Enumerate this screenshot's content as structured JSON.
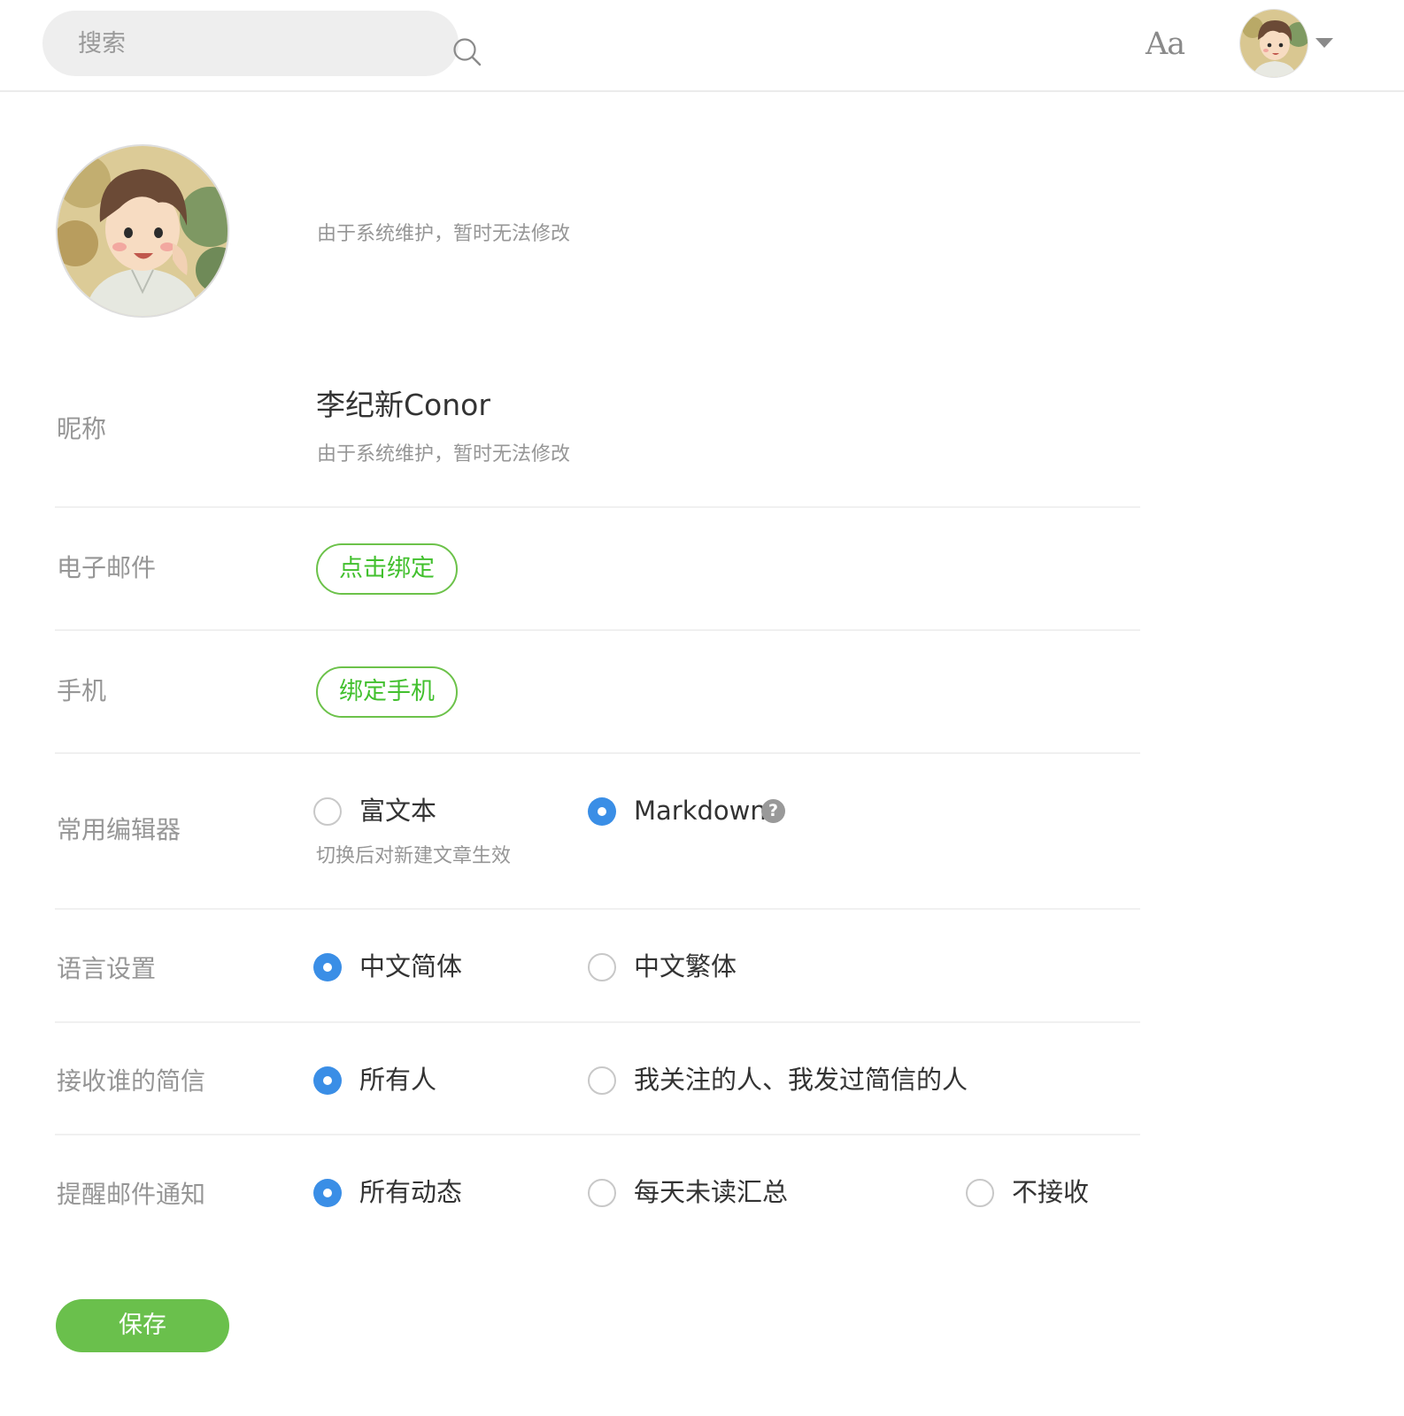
{
  "header": {
    "search_placeholder": "搜索",
    "font_toggle": "Aa"
  },
  "avatar_section": {
    "hint": "由于系统维护，暂时无法修改"
  },
  "nickname": {
    "label": "昵称",
    "value": "李纪新Conor",
    "hint": "由于系统维护，暂时无法修改"
  },
  "email": {
    "label": "电子邮件",
    "button": "点击绑定"
  },
  "phone": {
    "label": "手机",
    "button": "绑定手机"
  },
  "editor": {
    "label": "常用编辑器",
    "options": [
      {
        "label": "富文本",
        "checked": false
      },
      {
        "label": "Markdown",
        "checked": true
      }
    ],
    "help": "?",
    "hint": "切换后对新建文章生效"
  },
  "language": {
    "label": "语言设置",
    "options": [
      {
        "label": "中文简体",
        "checked": true
      },
      {
        "label": "中文繁体",
        "checked": false
      }
    ]
  },
  "messages": {
    "label": "接收谁的简信",
    "options": [
      {
        "label": "所有人",
        "checked": true
      },
      {
        "label": "我关注的人、我发过简信的人",
        "checked": false
      }
    ]
  },
  "email_notify": {
    "label": "提醒邮件通知",
    "options": [
      {
        "label": "所有动态",
        "checked": true
      },
      {
        "label": "每天未读汇总",
        "checked": false
      },
      {
        "label": "不接收",
        "checked": false
      }
    ]
  },
  "save_button": "保存",
  "colors": {
    "accent_green": "#6ac04c",
    "radio_blue": "#3a8ee6",
    "muted_text": "#969696"
  }
}
